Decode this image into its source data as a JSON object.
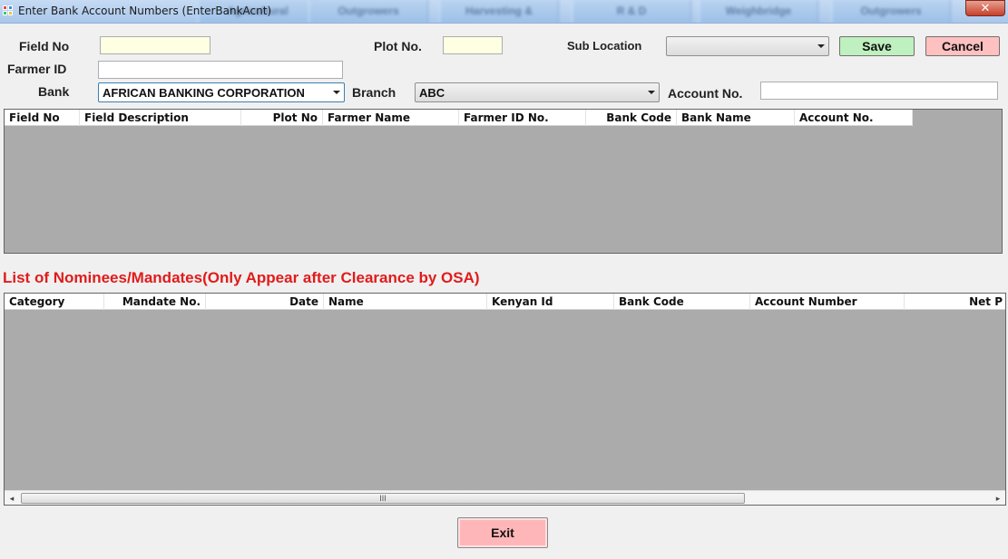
{
  "window": {
    "title": "Enter Bank Account Numbers (EnterBankAcnt)",
    "close_glyph": "✕",
    "background_tabs": [
      "Agricultural",
      "Outgrowers",
      "Harvesting &",
      "R & D",
      "Weighbridge",
      "Outgrowers"
    ]
  },
  "form": {
    "field_no_label": "Field No",
    "plot_no_label": "Plot No.",
    "sub_location_label": "Sub Location",
    "sub_location_value": "",
    "farmer_id_label": "Farmer ID",
    "bank_label": "Bank",
    "bank_value": "AFRICAN BANKING CORPORATION",
    "branch_label": "Branch",
    "branch_value": "ABC",
    "account_no_label": "Account No.",
    "save_label": "Save",
    "cancel_label": "Cancel"
  },
  "fields_grid": {
    "columns": [
      "Field No",
      "Field Description",
      "Plot No",
      "Farmer Name",
      "Farmer ID No.",
      "Bank Code",
      "Bank Name",
      "Account No."
    ],
    "rows": []
  },
  "nominees": {
    "title": "List of Nominees/Mandates(Only Appear after Clearance by OSA)",
    "columns": [
      "Category",
      "Mandate No.",
      "Date",
      "Name",
      "Kenyan Id",
      "Bank Code",
      "Account Number",
      "Net P"
    ],
    "rows": [],
    "scroll_left": "◂",
    "scroll_right": "▸",
    "scroll_grip": "III"
  },
  "footer": {
    "exit_label": "Exit"
  },
  "colors": {
    "save": "#bff0bf",
    "cancel": "#ffc0c0",
    "exit": "#ffb6b9",
    "section_title": "#e11b1b",
    "grid_bg": "#ababab"
  }
}
